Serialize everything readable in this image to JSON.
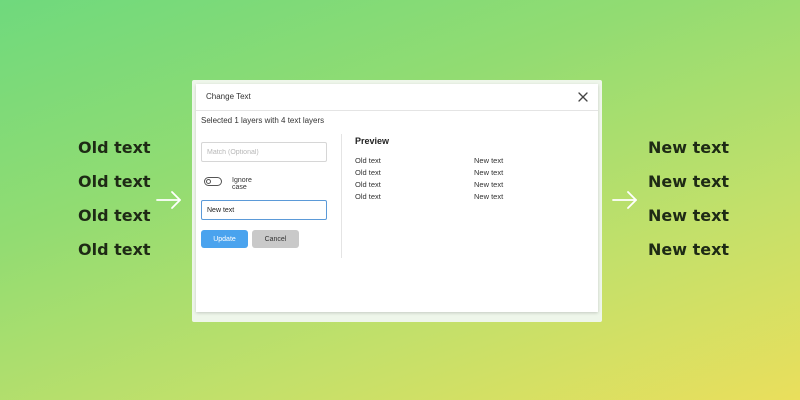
{
  "background": {
    "old_texts": [
      "Old text",
      "Old text",
      "Old text",
      "Old text"
    ],
    "new_texts": [
      "New text",
      "New text",
      "New text",
      "New text"
    ],
    "arrow_icon": "arrow-right-icon"
  },
  "dialog": {
    "title": "Change Text",
    "close_icon": "close-icon",
    "summary": "Selected 1 layers with 4 text layers",
    "match_placeholder": "Match (Optional)",
    "ignore_case_label": "Ignore case",
    "ignore_case_on": false,
    "replace_value": "New text",
    "update_label": "Update",
    "cancel_label": "Cancel",
    "update_color": "#4aa3ee",
    "cancel_color": "#c9c9c9",
    "preview": {
      "title": "Preview",
      "rows": [
        {
          "old": "Old text",
          "new": "New text"
        },
        {
          "old": "Old text",
          "new": "New text"
        },
        {
          "old": "Old text",
          "new": "New text"
        },
        {
          "old": "Old text",
          "new": "New text"
        }
      ]
    }
  }
}
